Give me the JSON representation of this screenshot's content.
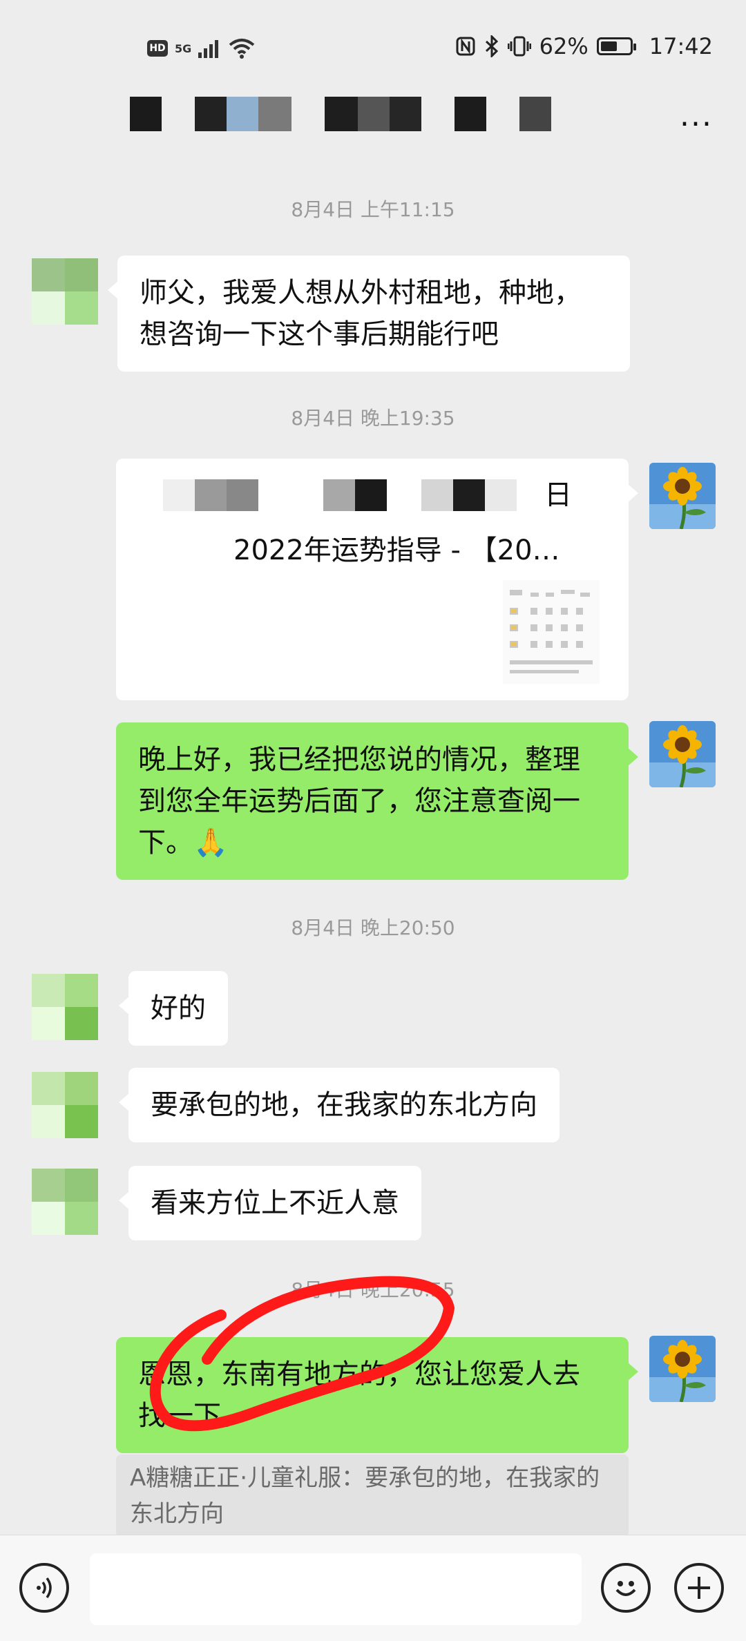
{
  "status_bar": {
    "hd": "HD",
    "signal": "5G",
    "battery_percent": "62%",
    "time": "17:42",
    "battery_level": 0.62
  },
  "header": {
    "more_label": "..."
  },
  "messages": {
    "ts1": "8月4日 上午11:15",
    "m1": "师父，我爱人想从外村租地，种地，想咨询一下这个事后期能行吧",
    "ts2": "8月4日 晚上19:35",
    "card_title_end": "日",
    "card_subtitle": "2022年运势指导 - 【20…",
    "m2": "晚上好，我已经把您说的情况，整理到您全年运势后面了，您注意查阅一下。🙏",
    "ts3": "8月4日 晚上20:50",
    "m3": "好的",
    "m4": "要承包的地，在我家的东北方向",
    "m5": "看来方位上不近人意",
    "ts4": "8月4日 晚上20:55",
    "m6": "恩恩，东南有地方的，您让您爱人去找一下。",
    "quote": "A糖糖正正·儿童礼服：要承包的地，在我家的东北方向"
  },
  "colors": {
    "bubble_green": "#95ec69",
    "annotation_red": "#ff1a1a",
    "background": "#ededed"
  },
  "icons": {
    "voice": "voice-icon",
    "emoji": "emoji-icon",
    "plus": "plus-icon",
    "more": "more-icon"
  }
}
